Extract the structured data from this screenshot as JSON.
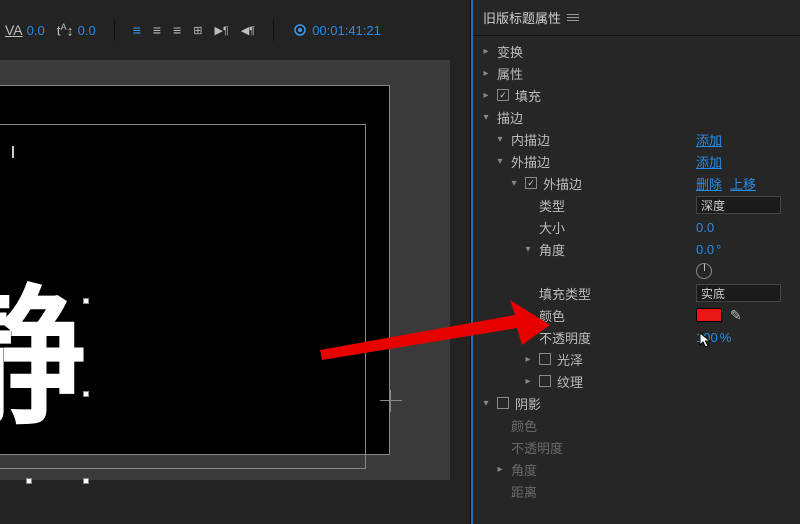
{
  "toolbar": {
    "va_value": "0.0",
    "baseline_value": "0.0",
    "timecode": "00:01:41:21"
  },
  "canvas": {
    "large_text": "静"
  },
  "panel": {
    "title": "旧版标题属性",
    "transform": "变换",
    "properties": "属性",
    "fill": "填充",
    "stroke": "描边",
    "inner_stroke": "内描边",
    "outer_stroke": "外描边",
    "outer_stroke_item": "外描边",
    "add": "添加",
    "delete": "删除",
    "move_up": "上移",
    "type": "类型",
    "type_value": "深度",
    "size": "大小",
    "size_value": "0.0",
    "angle": "角度",
    "angle_value": "0.0",
    "angle_unit": "°",
    "fill_type": "填充类型",
    "fill_type_value": "实底",
    "color": "颜色",
    "color_value": "#e81818",
    "opacity": "不透明度",
    "opacity_value": "100",
    "opacity_unit": " %",
    "sheen": "光泽",
    "texture": "纹理",
    "shadow": "阴影",
    "shadow_color": "颜色",
    "shadow_opacity": "不透明度",
    "shadow_angle": "角度",
    "shadow_distance": "距离"
  }
}
